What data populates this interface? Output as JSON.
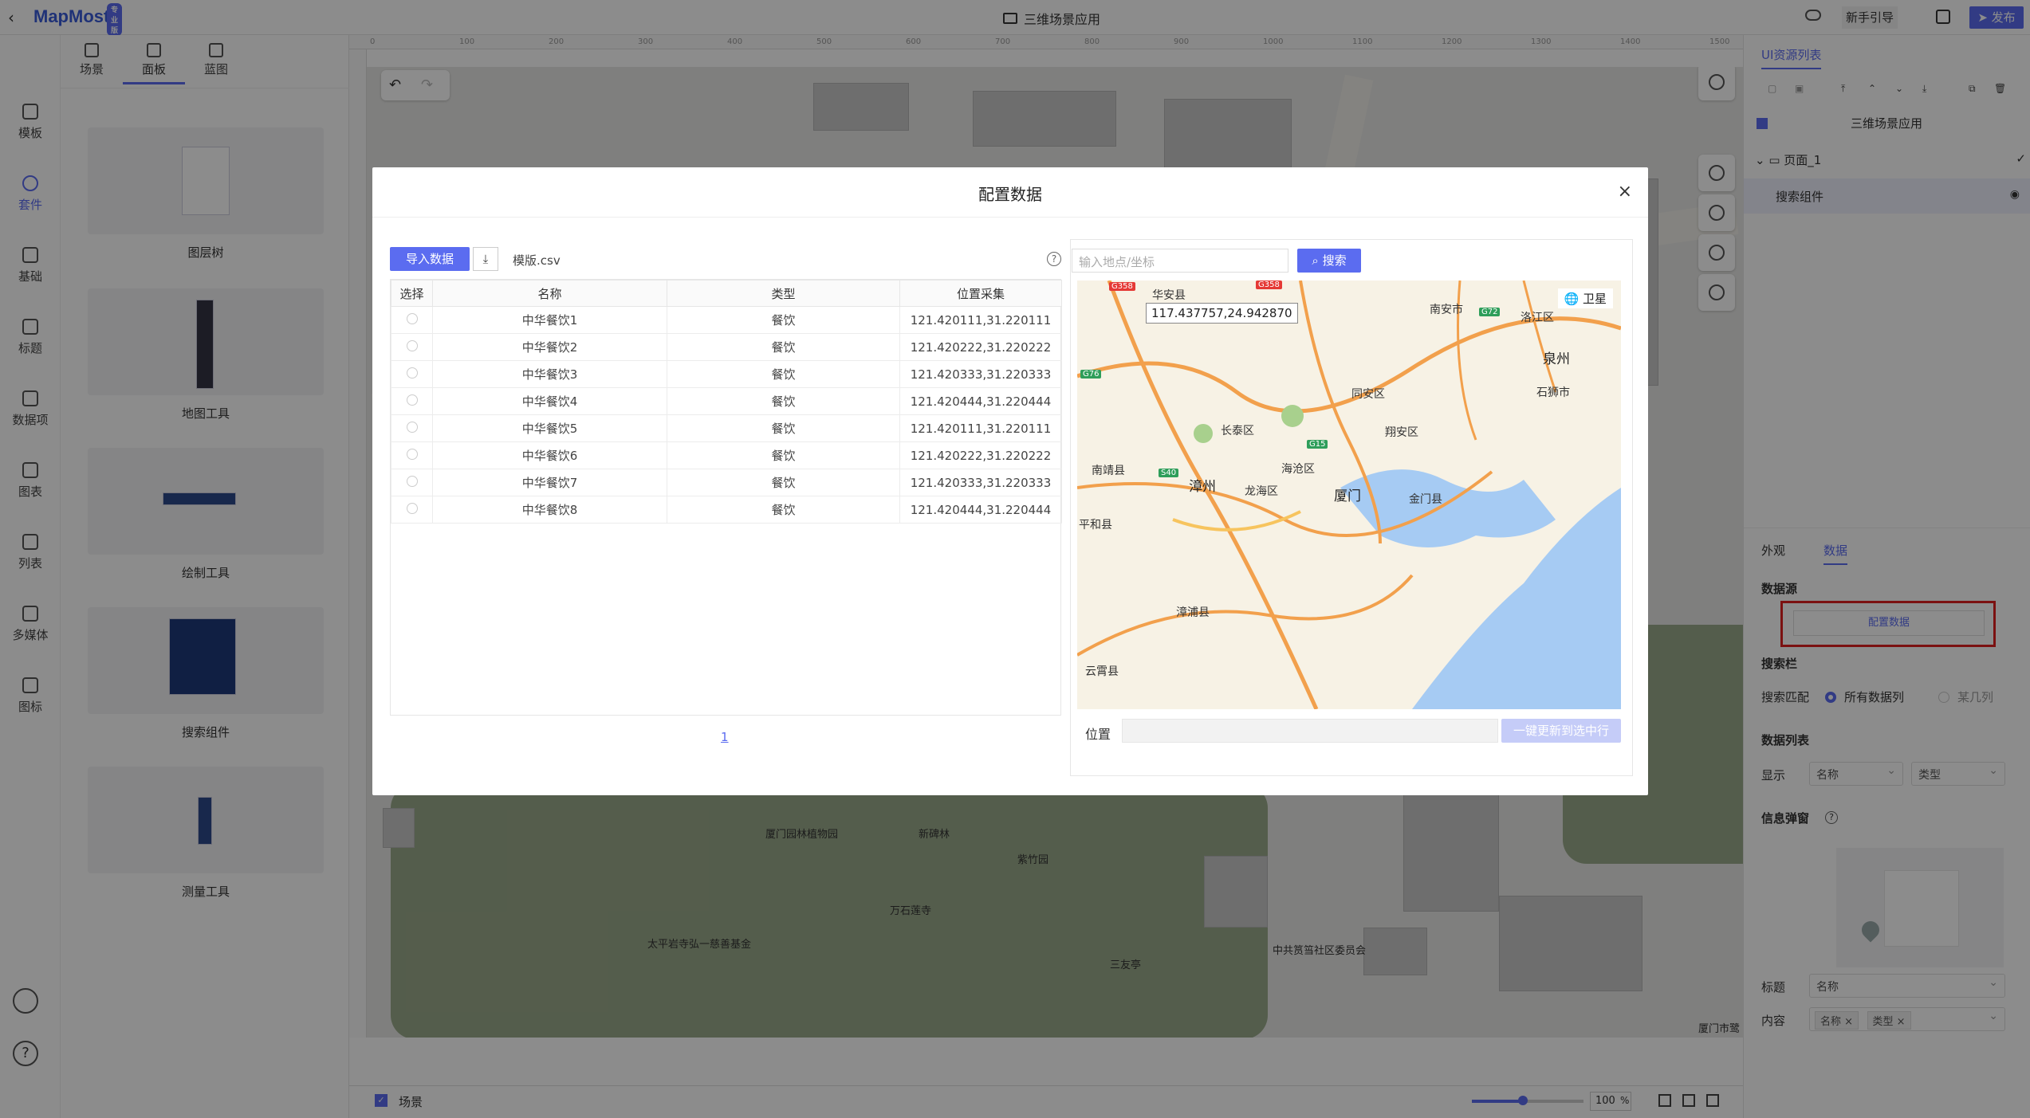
{
  "app": {
    "logo": "MapMost",
    "logo_badge": "专业版",
    "title": "三维场景应用",
    "guide_label": "新手引导",
    "publish_label": "发布"
  },
  "left_tabs": [
    "场景",
    "面板",
    "蓝图"
  ],
  "rail": [
    "模板",
    "套件",
    "基础",
    "标题",
    "数据项",
    "图表",
    "列表",
    "多媒体",
    "图标"
  ],
  "components": [
    "图层树",
    "地图工具",
    "绘制工具",
    "搜索组件",
    "测量工具"
  ],
  "ruler_ticks": [
    "0",
    "100",
    "200",
    "300",
    "400",
    "500",
    "600",
    "700",
    "800",
    "900",
    "1000",
    "1100",
    "1200",
    "1300",
    "1400",
    "1500"
  ],
  "map_labels": [
    "厦门园林植物园",
    "新碑林",
    "紫竹园",
    "万石莲寺",
    "太平岩寺弘一慈善基金",
    "三友亭",
    "中共筼筜社区委员会",
    "厦门市鹭"
  ],
  "status": {
    "scene_label": "场景",
    "zoom": "100",
    "zoom_unit": "%"
  },
  "right_panel": {
    "title": "UI资源列表",
    "tree_root": "三维场景应用",
    "tree_page": "页面_1",
    "tree_item": "搜索组件",
    "tabs": [
      "外观",
      "数据"
    ],
    "datasource_label": "数据源",
    "config_btn": "配置数据",
    "searchbar_label": "搜索栏",
    "match_label": "搜索匹配",
    "match_opt1": "所有数据列",
    "match_opt2": "某几列",
    "list_label": "数据列表",
    "display_label": "显示",
    "display_sel1": "名称",
    "display_sel2": "类型",
    "info_label": "信息弹窗",
    "title_label": "标题",
    "title_sel": "名称",
    "content_label": "内容",
    "content_tags": [
      "名称",
      "类型"
    ]
  },
  "modal": {
    "title": "配置数据",
    "close": "×",
    "import_btn": "导入数据",
    "download_icon": "download-icon",
    "csv_name": "模版.csv",
    "columns": [
      "选择",
      "名称",
      "类型",
      "位置采集"
    ],
    "rows": [
      {
        "name": "中华餐饮1",
        "type": "餐饮",
        "loc": "121.420111,31.220111"
      },
      {
        "name": "中华餐饮2",
        "type": "餐饮",
        "loc": "121.420222,31.220222"
      },
      {
        "name": "中华餐饮3",
        "type": "餐饮",
        "loc": "121.420333,31.220333"
      },
      {
        "name": "中华餐饮4",
        "type": "餐饮",
        "loc": "121.420444,31.220444"
      },
      {
        "name": "中华餐饮5",
        "type": "餐饮",
        "loc": "121.420111,31.220111"
      },
      {
        "name": "中华餐饮6",
        "type": "餐饮",
        "loc": "121.420222,31.220222"
      },
      {
        "name": "中华餐饮7",
        "type": "餐饮",
        "loc": "121.420333,31.220333"
      },
      {
        "name": "中华餐饮8",
        "type": "餐饮",
        "loc": "121.420444,31.220444"
      }
    ],
    "page": "1",
    "search_placeholder": "输入地点/坐标",
    "search_btn": "搜索",
    "coord_tip": "117.437757,24.942870",
    "sat_btn": "卫星",
    "location_label": "位置",
    "update_btn": "一键更新到选中行",
    "cities": [
      "泉州",
      "漳州",
      "厦门",
      "同安区",
      "翔安区",
      "长泰区",
      "南靖县",
      "龙海区",
      "海沧区",
      "南安市",
      "石狮市",
      "洛江区",
      "平和县",
      "漳浦县",
      "云霄县",
      "华安县",
      "金门县"
    ],
    "highways": [
      "G358",
      "G358",
      "G72",
      "G76",
      "G15",
      "S40"
    ]
  },
  "colors": {
    "accent": "#5b6cf0",
    "highlight": "#e02020",
    "disabled_btn": "#c5ccf8"
  }
}
